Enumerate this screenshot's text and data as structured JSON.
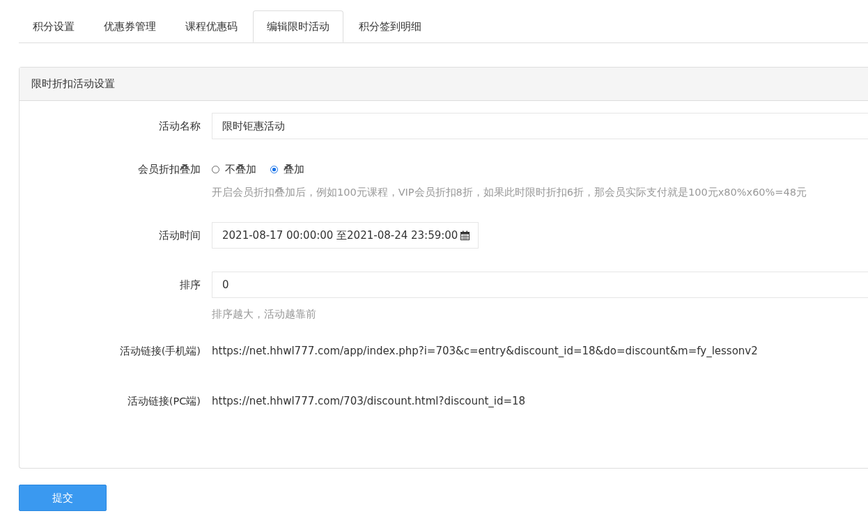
{
  "tabs": [
    {
      "label": "积分设置",
      "selected": false
    },
    {
      "label": "优惠券管理",
      "selected": false
    },
    {
      "label": "课程优惠码",
      "selected": false
    },
    {
      "label": "编辑限时活动",
      "selected": true
    },
    {
      "label": "积分签到明细",
      "selected": false
    }
  ],
  "panel": {
    "title": "限时折扣活动设置",
    "rows": [
      {
        "kind": "input",
        "label": "活动名称",
        "value": "限时钜惠活动"
      },
      {
        "kind": "radio",
        "label": "会员折扣叠加",
        "options": [
          {
            "label": "不叠加",
            "selected": false
          },
          {
            "label": "叠加",
            "selected": true
          }
        ],
        "help": "开启会员折扣叠加后，例如100元课程，VIP会员折扣8折，如果此时限时折扣6折，那会员实际支付就是100元x80%x60%=48元"
      },
      {
        "kind": "date",
        "label": "活动时间",
        "value": "2021-08-17 00:00:00 至2021-08-24 23:59:00"
      },
      {
        "kind": "input",
        "label": "排序",
        "value": "0",
        "help": "排序越大，活动越靠前"
      },
      {
        "kind": "text",
        "label": "活动链接(手机端)",
        "value": "https://net.hhwl777.com/app/index.php?i=703&c=entry&discount_id=18&do=discount&m=fy_lessonv2"
      },
      {
        "kind": "text",
        "label": "活动链接(PC端)",
        "value": "https://net.hhwl777.com/703/discount.html?discount_id=18"
      }
    ]
  },
  "submit": "提交"
}
